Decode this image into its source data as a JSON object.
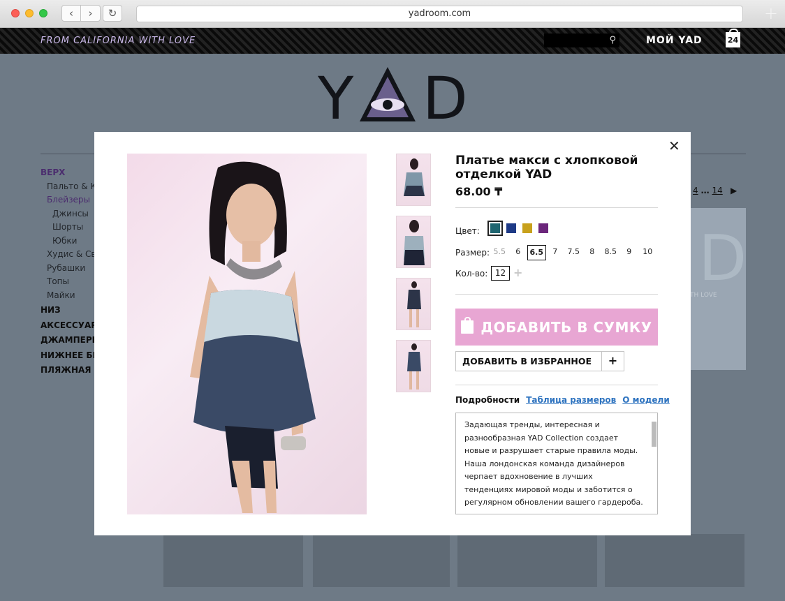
{
  "browser": {
    "url": "yadroom.com",
    "back_icon": "chevron-left-icon",
    "forward_icon": "chevron-right-icon",
    "reload_icon": "reload-icon",
    "new_tab_icon": "plus-icon"
  },
  "topbar": {
    "tagline": "FROM CALIFORNIA WITH LOVE",
    "account_label": "МОЙ YAD",
    "cart_count": "24"
  },
  "logo": {
    "text": "YAD"
  },
  "sidenav": {
    "top": "ВЕРХ",
    "sub": [
      "Пальто & К",
      "Блейзеры"
    ],
    "sub2": [
      "Джинсы",
      "Шорты",
      "Юбки"
    ],
    "sub_more": [
      "Худис & Св",
      "Рубашки",
      "Топы",
      "Майки"
    ],
    "main": [
      "НИЗ",
      "АКСЕССУАРЫ",
      "ДЖАМПЕРЫ",
      "НИЖНЕЕ БЕЛ",
      "ПЛЯЖНАЯ О"
    ]
  },
  "pager": {
    "page": "4",
    "ellipsis": "…",
    "last": "14"
  },
  "banner": {
    "letter": "D",
    "text": "TH LOVE"
  },
  "product": {
    "title": "Платье макси с хлопковой отделкой YAD",
    "price": "68.00 ₸",
    "color_label": "Цвет:",
    "colors": [
      "#1f6570",
      "#1e3a86",
      "#c8a11c",
      "#6b267b"
    ],
    "size_label": "Размер:",
    "sizes": [
      "5.5",
      "6",
      "6.5",
      "7",
      "7.5",
      "8",
      "8.5",
      "9",
      "10"
    ],
    "size_selected": "6.5",
    "qty_label": "Кол-во:",
    "qty": "12",
    "add_to_bag": "ДОБАВИТЬ В СУМКУ",
    "add_to_favorites": "ДОБАВИТЬ В ИЗБРАННОЕ",
    "tabs": [
      "Подробности",
      "Таблица размеров",
      "О модели"
    ],
    "description": "Задающая тренды, интересная и разнообразная YAD Collection создает новые и разрушает старые правила моды. Наша лондонская команда дизайнеров черпает вдохновение в лучших тенденциях мировой моды и заботится о регулярном обновлении вашего гардероба."
  }
}
